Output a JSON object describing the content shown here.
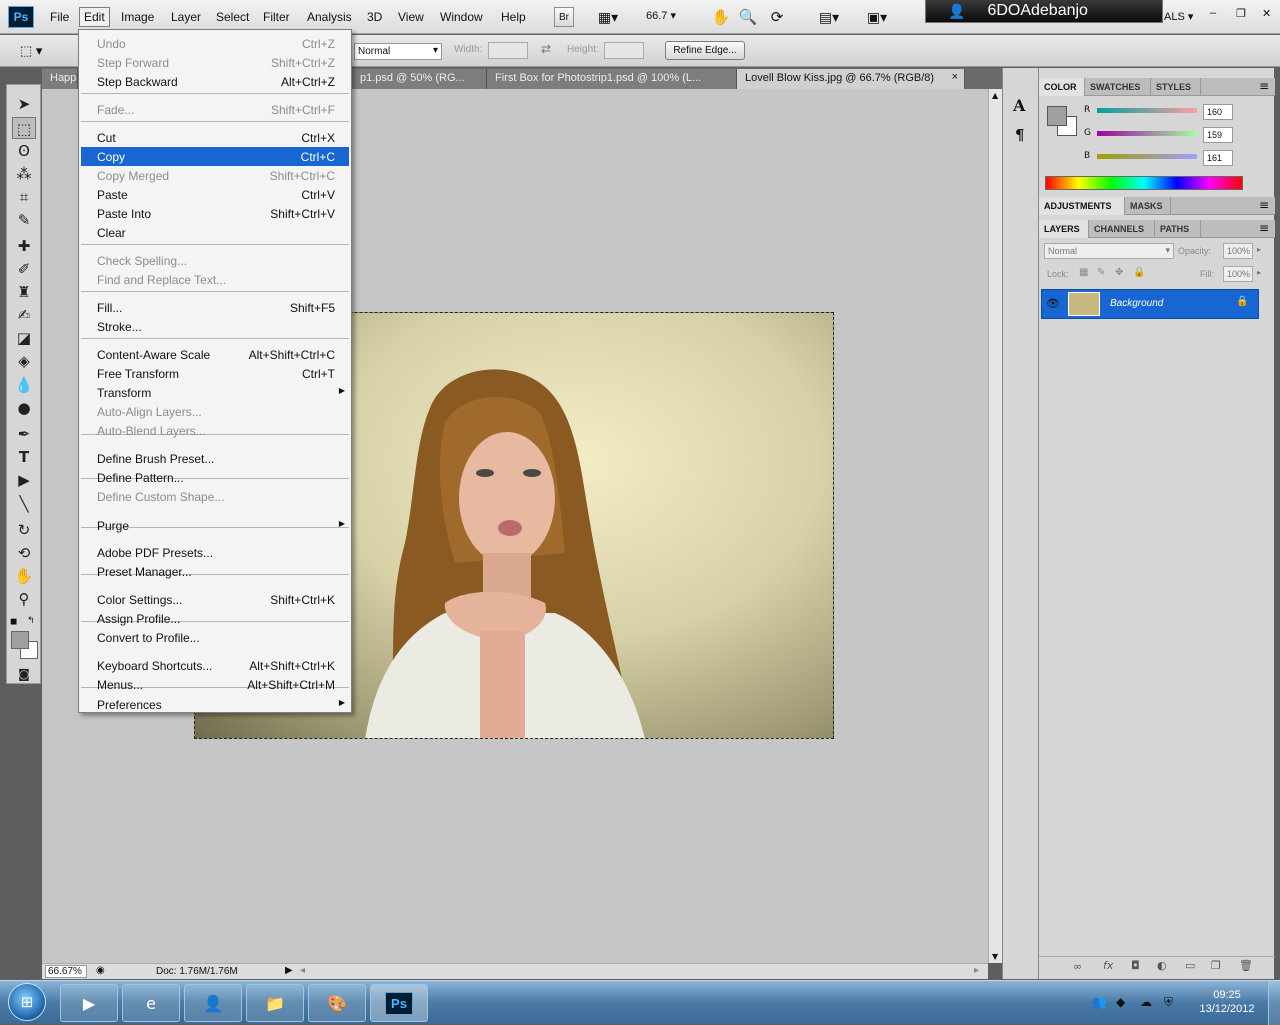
{
  "app": {
    "logo": "Ps",
    "menu": [
      "File",
      "Edit",
      "Image",
      "Layer",
      "Select",
      "Filter",
      "Analysis",
      "3D",
      "View",
      "Window",
      "Help"
    ],
    "zoom_value": "66.7",
    "bridge_label": "Br",
    "user": "6DOAdebanjo",
    "workspace_fragment": "ALS"
  },
  "options": {
    "style_value": "Normal",
    "width_label": "Width:",
    "height_label": "Height:",
    "refine_edge": "Refine Edge..."
  },
  "tabs": [
    {
      "label": "Happ",
      "active": false
    },
    {
      "label": "p1.psd @ 50% (RG...",
      "active": false
    },
    {
      "label": "First Box for Photostrip1.psd @ 100% (L...",
      "active": false
    },
    {
      "label": "Lovell Blow Kiss.jpg @ 66.7% (RGB/8)",
      "active": true
    }
  ],
  "tab_close": "×",
  "edit_menu": {
    "items": [
      {
        "label": "Undo",
        "shortcut": "Ctrl+Z",
        "disabled": true
      },
      {
        "label": "Step Forward",
        "shortcut": "Shift+Ctrl+Z",
        "disabled": true
      },
      {
        "label": "Step Backward",
        "shortcut": "Alt+Ctrl+Z",
        "disabled": false
      },
      {
        "label": "Fade...",
        "shortcut": "Shift+Ctrl+F",
        "disabled": true
      },
      {
        "label": "Cut",
        "shortcut": "Ctrl+X",
        "disabled": false
      },
      {
        "label": "Copy",
        "shortcut": "Ctrl+C",
        "disabled": false,
        "highlighted": true
      },
      {
        "label": "Copy Merged",
        "shortcut": "Shift+Ctrl+C",
        "disabled": true
      },
      {
        "label": "Paste",
        "shortcut": "Ctrl+V",
        "disabled": false
      },
      {
        "label": "Paste Into",
        "shortcut": "Shift+Ctrl+V",
        "disabled": false
      },
      {
        "label": "Clear",
        "shortcut": "",
        "disabled": false
      },
      {
        "label": "Check Spelling...",
        "shortcut": "",
        "disabled": true
      },
      {
        "label": "Find and Replace Text...",
        "shortcut": "",
        "disabled": true
      },
      {
        "label": "Fill...",
        "shortcut": "Shift+F5",
        "disabled": false
      },
      {
        "label": "Stroke...",
        "shortcut": "",
        "disabled": false
      },
      {
        "label": "Content-Aware Scale",
        "shortcut": "Alt+Shift+Ctrl+C",
        "disabled": false
      },
      {
        "label": "Free Transform",
        "shortcut": "Ctrl+T",
        "disabled": false
      },
      {
        "label": "Transform",
        "shortcut": "",
        "disabled": false,
        "submenu": true
      },
      {
        "label": "Auto-Align Layers...",
        "shortcut": "",
        "disabled": true
      },
      {
        "label": "Auto-Blend Layers...",
        "shortcut": "",
        "disabled": true
      },
      {
        "label": "Define Brush Preset...",
        "shortcut": "",
        "disabled": false
      },
      {
        "label": "Define Pattern...",
        "shortcut": "",
        "disabled": false
      },
      {
        "label": "Define Custom Shape...",
        "shortcut": "",
        "disabled": true
      },
      {
        "label": "Purge",
        "shortcut": "",
        "disabled": false,
        "submenu": true
      },
      {
        "label": "Adobe PDF Presets...",
        "shortcut": "",
        "disabled": false
      },
      {
        "label": "Preset Manager...",
        "shortcut": "",
        "disabled": false
      },
      {
        "label": "Color Settings...",
        "shortcut": "Shift+Ctrl+K",
        "disabled": false
      },
      {
        "label": "Assign Profile...",
        "shortcut": "",
        "disabled": false
      },
      {
        "label": "Convert to Profile...",
        "shortcut": "",
        "disabled": false
      },
      {
        "label": "Keyboard Shortcuts...",
        "shortcut": "Alt+Shift+Ctrl+K",
        "disabled": false
      },
      {
        "label": "Menus...",
        "shortcut": "Alt+Shift+Ctrl+M",
        "disabled": false
      },
      {
        "label": "Preferences",
        "shortcut": "",
        "disabled": false,
        "submenu": true
      }
    ],
    "submenu_arrow": "▶"
  },
  "color_panel": {
    "tabs": [
      "COLOR",
      "SWATCHES",
      "STYLES"
    ],
    "channels": [
      {
        "name": "R",
        "value": "160"
      },
      {
        "name": "G",
        "value": "159"
      },
      {
        "name": "B",
        "value": "161"
      }
    ],
    "foreground_color": "#a09fa1"
  },
  "adjustments_panel": {
    "tabs": [
      "ADJUSTMENTS",
      "MASKS"
    ]
  },
  "layers_panel": {
    "tabs": [
      "LAYERS",
      "CHANNELS",
      "PATHS"
    ],
    "blend_mode": "Normal",
    "opacity_label": "Opacity:",
    "opacity_value": "100%",
    "lock_label": "Lock:",
    "fill_label": "Fill:",
    "fill_value": "100%",
    "layers": [
      {
        "name": "Background",
        "selected": true
      }
    ]
  },
  "status": {
    "zoom": "66.67%",
    "doc_info": "Doc: 1.76M/1.76M"
  },
  "taskbar": {
    "clock_time": "09:25",
    "clock_date": "13/12/2012",
    "apps": [
      "media-player-icon",
      "internet-explorer-icon",
      "user-icon",
      "folder-icon",
      "paint-icon",
      "photoshop-icon"
    ],
    "photoshop_label": "Ps"
  },
  "colors": {
    "highlight": "#1766d1",
    "canvas_bg": "#c6c6c6",
    "panel_bg": "#d6d6d6"
  }
}
